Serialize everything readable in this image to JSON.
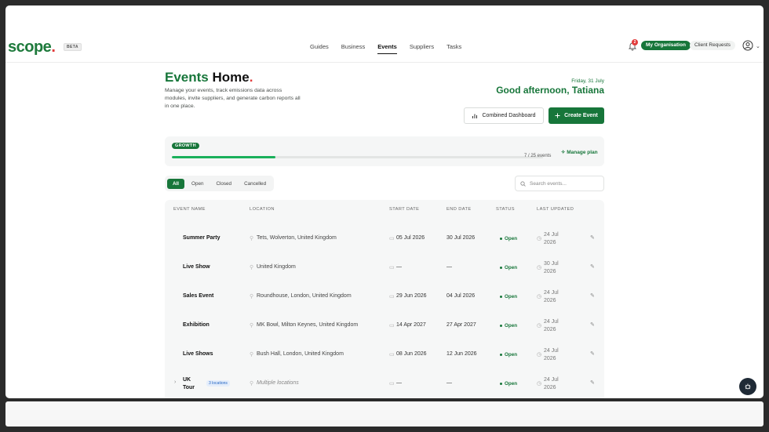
{
  "nav": {
    "logo": "scope",
    "logo_dot": ".",
    "beta": "BETA",
    "links": [
      {
        "label": "Guides"
      },
      {
        "label": "Business"
      },
      {
        "label": "Events"
      },
      {
        "label": "Suppliers"
      },
      {
        "label": "Tasks"
      }
    ],
    "notif_count": "2",
    "my_org": "My Organisation",
    "client_requests": "Client Requests"
  },
  "header": {
    "title_green": "Events",
    "title_dark": "Home",
    "title_dot": ".",
    "description": "Manage your events, track emissions data across modules, invite suppliers, and generate carbon reports all in one place.",
    "date": "Friday, 31 July",
    "greeting": "Good afternoon, Tatiana",
    "combined_dashboard": "Combined Dashboard",
    "create_event": "Create Event"
  },
  "plan": {
    "badge": "GROWTH",
    "progress": 0.28,
    "count_text": "7 / 25 events",
    "manage": "Manage plan"
  },
  "filters": {
    "options": [
      {
        "label": "All"
      },
      {
        "label": "Open"
      },
      {
        "label": "Closed"
      },
      {
        "label": "Cancelled"
      }
    ],
    "search_placeholder": "Search events..."
  },
  "table": {
    "headers": {
      "name": "EVENT NAME",
      "location": "LOCATION",
      "start": "START DATE",
      "end": "END DATE",
      "status": "STATUS",
      "updated": "LAST UPDATED"
    },
    "rows": [
      {
        "name": "Summer Party",
        "location": "Tets, Wolverton, United Kingdom",
        "start": "05 Jul 2026",
        "end": "30 Jul 2026",
        "status": "Open",
        "updated_1": "24 Jul",
        "updated_2": "2026"
      },
      {
        "name": "Live Show",
        "location": "United Kingdom",
        "start": "—",
        "end": "—",
        "status": "Open",
        "updated_1": "30 Jul",
        "updated_2": "2026"
      },
      {
        "name": "Sales Event",
        "location": "Roundhouse, London, United Kingdom",
        "start": "29 Jun 2026",
        "end": "04 Jul 2026",
        "status": "Open",
        "updated_1": "24 Jul",
        "updated_2": "2026"
      },
      {
        "name": "Exhibition",
        "location": "MK Bowl, Milton Keynes, United Kingdom",
        "start": "14 Apr 2027",
        "end": "27 Apr 2027",
        "status": "Open",
        "updated_1": "24 Jul",
        "updated_2": "2026"
      },
      {
        "name": "Live Shows",
        "location": "Bush Hall, London, United Kingdom",
        "start": "08 Jun 2026",
        "end": "12 Jun 2026",
        "status": "Open",
        "updated_1": "24 Jul",
        "updated_2": "2026"
      },
      {
        "name_1": "UK",
        "name_2": "Tour",
        "badge": "3 locations",
        "location": "Multiple locations",
        "start": "—",
        "end": "—",
        "status": "Open",
        "updated_1": "24 Jul",
        "updated_2": "2026"
      }
    ]
  },
  "colors": {
    "brand": "#17763a",
    "accent_red": "#e23b3b",
    "progress": "#1ab05b"
  }
}
